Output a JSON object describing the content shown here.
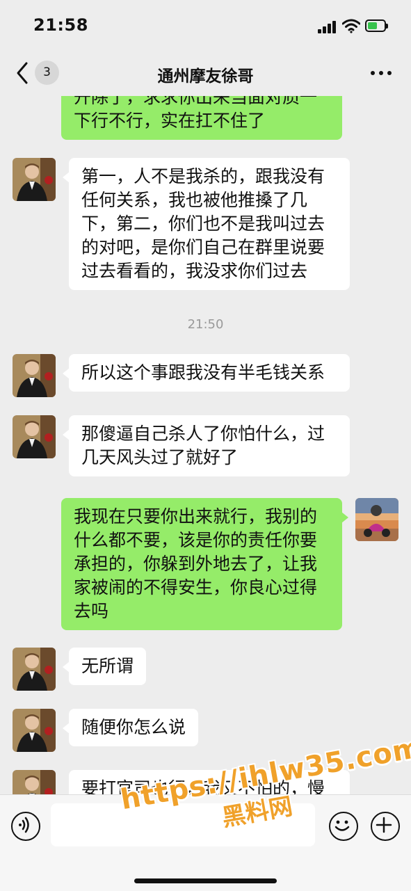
{
  "status_bar": {
    "time": "21:58"
  },
  "header": {
    "back_badge_count": "3",
    "title": "通州摩友徐哥"
  },
  "messages": [
    {
      "from": "me",
      "text": "开除了，求求你出来当面对质一下行不行，实在扛不住了"
    },
    {
      "from": "contact",
      "text": "第一，人不是我杀的，跟我没有任何关系，我也被他推搡了几下，第二，你们也不是我叫过去的对吧，是你们自己在群里说要过去看看的，我没求你们过去"
    },
    {
      "timestamp": "21:50"
    },
    {
      "from": "contact",
      "text": "所以这个事跟我没有半毛钱关系"
    },
    {
      "from": "contact",
      "text": "那傻逼自己杀人了你怕什么，过几天风头过了就好了"
    },
    {
      "from": "me",
      "text": "我现在只要你出来就行，我别的什么都不要，该是你的责任你要承担的，你躲到外地去了，让我家被闹的不得安生，你良心过得去吗"
    },
    {
      "from": "contact",
      "text": "无所谓"
    },
    {
      "from": "contact",
      "text": "随便你怎么说"
    },
    {
      "from": "contact",
      "text": "要打官司也行，我又不怕的，慢"
    }
  ],
  "watermark": {
    "url": "https://ihlw35.com",
    "name": "黑料网"
  },
  "icons": [
    "signal-icon",
    "wifi-icon",
    "battery-icon",
    "back-chevron-icon",
    "more-icon",
    "voice-icon",
    "emoji-icon",
    "plus-icon"
  ],
  "colors": {
    "outgoing_bubble": "#95ec69",
    "incoming_bubble": "#ffffff",
    "background": "#ededed"
  }
}
